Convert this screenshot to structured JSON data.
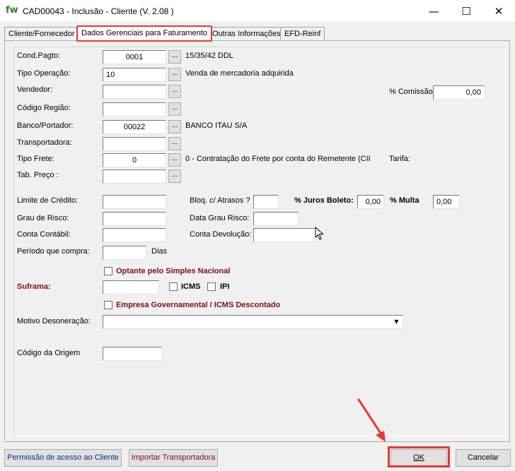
{
  "window": {
    "app_icon": "fw",
    "title": "CAD00043 - Inclusão - Cliente  (V.  2.08 )",
    "controls": {
      "minimize": "—",
      "maximize": "☐",
      "close": "✕"
    }
  },
  "tabs": [
    {
      "label": "Cliente/Fornecedor",
      "active": false
    },
    {
      "label": "Dados Gerenciais para Faturamento",
      "active": true
    },
    {
      "label": "Outras Informações",
      "active": false
    },
    {
      "label": "EFD-Reinf",
      "active": false
    }
  ],
  "form": {
    "cond_pagto": {
      "label": "Cond.Pagto:",
      "value": "0001",
      "description": "15/35/42 DDL"
    },
    "tipo_operacao": {
      "label": "Tipo Operação:",
      "value": "10",
      "description": "Venda de mercadoria adquirida"
    },
    "vendedor": {
      "label": "Vendedor:",
      "value": ""
    },
    "comissao": {
      "label": "% Comissão:",
      "value": "0,00"
    },
    "codigo_regiao": {
      "label": "Código Região:",
      "value": ""
    },
    "banco_portador": {
      "label": "Banco/Portador:",
      "value": "00022",
      "description": "BANCO ITAU S/A"
    },
    "transportadora": {
      "label": "Transportadora:",
      "value": ""
    },
    "tipo_frete": {
      "label": "Tipo Frete:",
      "value": "0",
      "description": "0 - Contratação do Frete por conta do Remetente (CII",
      "tarifa_label": "Tarifa:"
    },
    "tab_preco": {
      "label": "Tab. Preço :",
      "value": ""
    },
    "lookup_button": "...",
    "limite_credito": {
      "label": "Limite de Crédito:",
      "value": ""
    },
    "bloq_atrasos": {
      "label": "Bloq. c/ Atrasos ?",
      "value": ""
    },
    "juros_boleto": {
      "label": "% Juros Boleto:",
      "value": "0,00"
    },
    "multa": {
      "label": "% Multa",
      "value": "0,00"
    },
    "grau_risco": {
      "label": "Grau de Risco:",
      "value": ""
    },
    "data_grau_risco": {
      "label": "Data Grau Risco:",
      "value": ""
    },
    "conta_contabil": {
      "label": "Conta Contábil:",
      "value": ""
    },
    "conta_devolucao": {
      "label": "Conta Devolução:",
      "value": ""
    },
    "periodo_compra": {
      "label": "Período que compra:",
      "value": "",
      "unit": "Dias"
    },
    "optante_simples": {
      "label": "Optante pelo Simples Nacional",
      "checked": false
    },
    "suframa": {
      "label": "Suframa:",
      "value": "",
      "icms_label": "ICMS",
      "ipi_label": "IPI"
    },
    "empresa_gov": {
      "label": "Empresa Governamental / ICMS Descontado",
      "checked": false
    },
    "motivo_desoneracao": {
      "label": "Motivo Desoneração:",
      "value": ""
    },
    "codigo_origem": {
      "label": "Código da Origem",
      "value": ""
    }
  },
  "footer": {
    "permissao_button": "Permissão de acesso ao Cliente",
    "importar_button": "Importar Transportadora",
    "ok_button": "OK",
    "cancel_button": "Cancelar"
  },
  "colors": {
    "highlight": "#e53935",
    "label_maroon": "#7b1010",
    "link_blue": "#0d2b8a"
  }
}
